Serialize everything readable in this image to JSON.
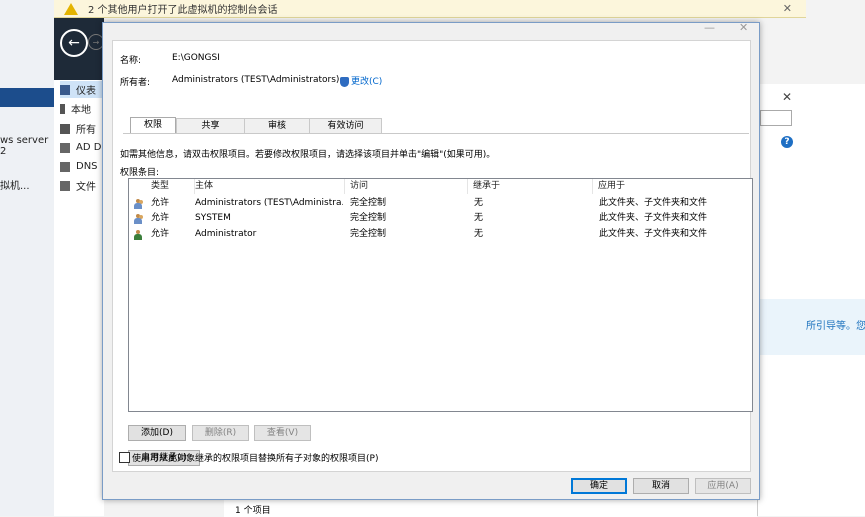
{
  "notification": {
    "text": "2 个其他用户打开了此虚拟机的控制台会话"
  },
  "background": {
    "left_items": [
      "ws server 2",
      "拟机..."
    ],
    "server_manager_nav": [
      {
        "label": "仪表",
        "selected": true
      },
      {
        "label": "本地"
      },
      {
        "label": "所有"
      },
      {
        "label": "AD D"
      },
      {
        "label": "DNS"
      },
      {
        "label": "文件"
      }
    ],
    "right_panel_text": "所引导等。您",
    "bottom_count": "1 个项目"
  },
  "dialog": {
    "name_label": "名称:",
    "name_value": "E:\\GONGSI",
    "owner_label": "所有者:",
    "owner_value": "Administrators (TEST\\Administrators)",
    "change_link": "更改(C)",
    "tabs": [
      "权限",
      "共享",
      "审核",
      "有效访问"
    ],
    "info_text": "如需其他信息，请双击权限项目。若要修改权限项目，请选择该项目并单击\"编辑\"(如果可用)。",
    "entries_label": "权限条目:",
    "columns": [
      "类型",
      "主体",
      "访问",
      "继承于",
      "应用于"
    ],
    "rows": [
      {
        "icon": "group",
        "type": "允许",
        "principal": "Administrators (TEST\\Administra...",
        "access": "完全控制",
        "inherited": "无",
        "applies": "此文件夹、子文件夹和文件"
      },
      {
        "icon": "group",
        "type": "允许",
        "principal": "SYSTEM",
        "access": "完全控制",
        "inherited": "无",
        "applies": "此文件夹、子文件夹和文件"
      },
      {
        "icon": "user",
        "type": "允许",
        "principal": "Administrator",
        "access": "完全控制",
        "inherited": "无",
        "applies": "此文件夹、子文件夹和文件"
      }
    ],
    "add_button": "添加(D)",
    "remove_button": "删除(R)",
    "view_button": "查看(V)",
    "enable_inherit_button": "启用继承(I)",
    "replace_checkbox_label": "使用可从此对象继承的权限项目替换所有子对象的权限项目(P)",
    "replace_checked": false,
    "ok_button": "确定",
    "cancel_button": "取消",
    "apply_button": "应用(A)"
  }
}
